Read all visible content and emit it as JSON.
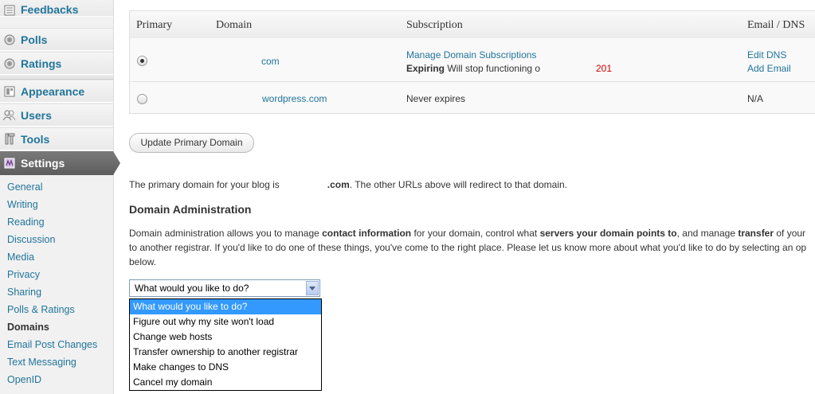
{
  "sidebar": {
    "menu": [
      {
        "label": "Feedbacks",
        "icon": "feedbacks-icon"
      },
      {
        "label": "Polls",
        "icon": "polls-icon"
      },
      {
        "label": "Ratings",
        "icon": "ratings-icon"
      },
      {
        "label": "Appearance",
        "icon": "appearance-icon"
      },
      {
        "label": "Users",
        "icon": "users-icon"
      },
      {
        "label": "Tools",
        "icon": "tools-icon"
      },
      {
        "label": "Settings",
        "icon": "settings-icon"
      }
    ],
    "submenu": [
      "General",
      "Writing",
      "Reading",
      "Discussion",
      "Media",
      "Privacy",
      "Sharing",
      "Polls & Ratings",
      "Domains",
      "Email Post Changes",
      "Text Messaging",
      "OpenID"
    ],
    "current_submenu": "Domains"
  },
  "table": {
    "headers": {
      "primary": "Primary",
      "domain": "Domain",
      "subscription": "Subscription",
      "email_dns": "Email / DNS"
    },
    "rows": [
      {
        "selected": true,
        "domain": "com",
        "subscription_link": "Manage Domain Subscriptions",
        "expiring_label": "Expiring",
        "expiring_text": "Will stop functioning o",
        "expiring_year": "201",
        "actions": [
          "Edit DNS",
          "Add Email"
        ]
      },
      {
        "selected": false,
        "domain": "wordpress.com",
        "subscription": "Never expires",
        "email_dns": "N/A"
      }
    ]
  },
  "update_button": "Update Primary Domain",
  "primary_note": {
    "before": "The primary domain for your blog is",
    "domain": ".com",
    "after": ". The other URLs above will redirect to that domain."
  },
  "domain_admin": {
    "heading": "Domain Administration",
    "line1_a": "Domain administration allows you to manage ",
    "line1_b": "contact information",
    "line1_c": " for your domain, control what ",
    "line1_d": "servers your domain points to",
    "line1_e": ", and manage ",
    "line1_f": "transfer",
    "line1_g": " of your",
    "line2": "to another registrar. If you'd like to do one of these things, you've come to the right place. Please let us know more about what you'd like to do by selecting an op",
    "line3": "below."
  },
  "select": {
    "value": "What would you like to do?",
    "options": [
      "What would you like to do?",
      "Figure out why my site won't load",
      "Change web hosts",
      "Transfer ownership to another registrar",
      "Make changes to DNS",
      "Cancel my domain"
    ],
    "highlighted": 0
  },
  "colors": {
    "link": "#21759b",
    "year_red": "#cc0000",
    "highlight": "#3399ff",
    "active_menu": "#6d6d6d"
  }
}
